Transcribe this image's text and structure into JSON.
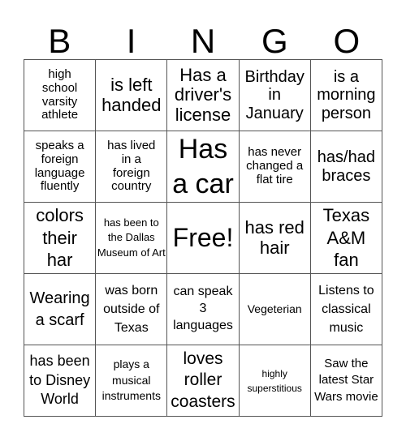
{
  "header": {
    "letters": [
      "B",
      "I",
      "N",
      "G",
      "O"
    ]
  },
  "cells": [
    [
      "high school varsity athlete",
      "is left handed",
      "Has a driver's license",
      "Birthday in January",
      "is a morning person"
    ],
    [
      "speaks a foreign language fluently",
      "has lived in a foreign country",
      "Has a car",
      "has never changed a flat tire",
      "has/had braces"
    ],
    [
      "colors their har",
      "has been to the Dallas Museum of Art",
      "Free!",
      "has red hair",
      "Texas A&M fan"
    ],
    [
      "Wearing a scarf",
      "was born outside of Texas",
      "can speak 3 languages",
      "Vegeterian",
      "Listens to classical music"
    ],
    [
      "has been to Disney World",
      "plays a musical instruments",
      "loves roller coasters",
      "highly superstitious",
      "Saw the latest Star Wars movie"
    ]
  ]
}
